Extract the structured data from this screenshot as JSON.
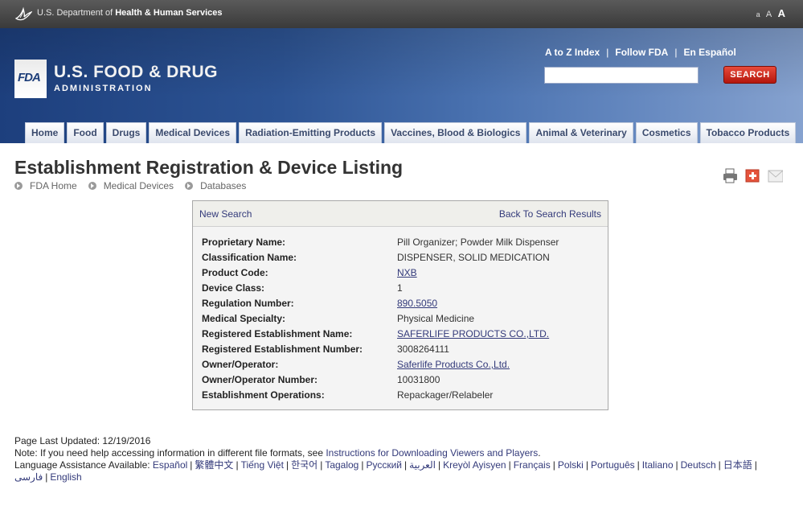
{
  "hhs": {
    "prefix": "U.S. Department of ",
    "name": "Health & Human Services",
    "font_small": "a",
    "font_medium": "A",
    "font_large": "A"
  },
  "header": {
    "logo_badge": "FDA",
    "title": "U.S. FOOD & DRUG",
    "subtitle": "ADMINISTRATION",
    "links": [
      "A to Z Index",
      "Follow FDA",
      "En Español"
    ],
    "link_separator": "|",
    "search_value": "",
    "search_button": "SEARCH"
  },
  "nav": {
    "tabs": [
      "Home",
      "Food",
      "Drugs",
      "Medical Devices",
      "Radiation-Emitting Products",
      "Vaccines, Blood & Biologics",
      "Animal & Veterinary",
      "Cosmetics",
      "Tobacco Products"
    ]
  },
  "page": {
    "title": "Establishment Registration & Device Listing",
    "breadcrumb": [
      "FDA Home",
      "Medical Devices",
      "Databases"
    ],
    "tools": [
      "print-icon",
      "share-icon",
      "email-icon"
    ]
  },
  "results": {
    "new_search": "New Search",
    "back_to_results": "Back To Search Results",
    "rows": [
      {
        "label": "Proprietary Name:",
        "value": "Pill Organizer; Powder Milk Dispenser"
      },
      {
        "label": "Classification Name:",
        "value": "DISPENSER, SOLID MEDICATION"
      },
      {
        "label": "Product Code:",
        "value": "NXB"
      },
      {
        "label": "Device Class:",
        "value": "1"
      },
      {
        "label": "Regulation Number:",
        "value": "890.5050"
      },
      {
        "label": "Medical Specialty:",
        "value": "Physical Medicine"
      },
      {
        "label": "Registered Establishment Name:",
        "value": "SAFERLIFE PRODUCTS CO.,LTD."
      },
      {
        "label": "Registered Establishment Number:",
        "value": "3008264111"
      },
      {
        "label": "Owner/Operator:",
        "value": "Saferlife Products Co.,Ltd."
      },
      {
        "label": "Owner/Operator Number:",
        "value": "10031800"
      },
      {
        "label": "Establishment Operations:",
        "value": "Repackager/Relabeler"
      }
    ]
  },
  "footer": {
    "last_updated": "Page Last Updated: 12/19/2016",
    "note_prefix": "Note: If you need help accessing information in different file formats, see ",
    "note_link": "Instructions for Downloading Viewers and Players",
    "note_suffix": ".",
    "language_label": "Language Assistance Available: ",
    "languages": [
      "Español",
      "繁體中文",
      "Tiếng Việt",
      "한국어",
      "Tagalog",
      "Русский",
      "العربية",
      "Kreyòl Ayisyen",
      "Français",
      "Polski",
      "Português",
      "Italiano",
      "Deutsch",
      "日本語",
      "فارسی",
      "English"
    ]
  },
  "colors": {
    "header_blue": "#2d5494",
    "search_red": "#c8281c",
    "link_blue": "#333a7a"
  }
}
